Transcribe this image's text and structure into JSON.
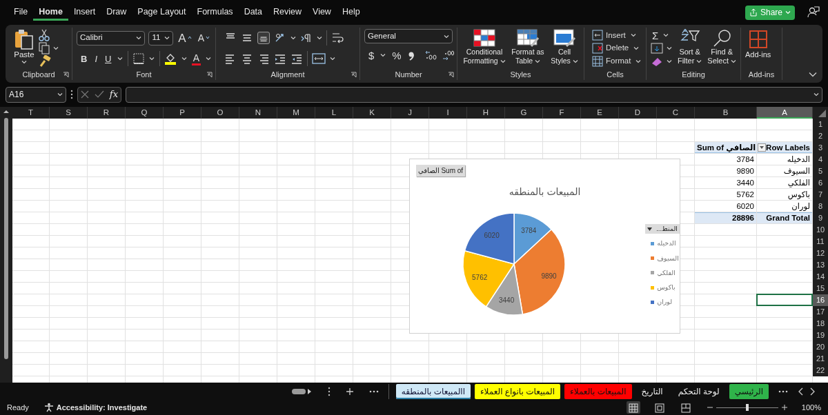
{
  "menu_tabs": [
    {
      "label": "File",
      "selected": false
    },
    {
      "label": "Home",
      "selected": true
    },
    {
      "label": "Insert",
      "selected": false
    },
    {
      "label": "Draw",
      "selected": false
    },
    {
      "label": "Page Layout",
      "selected": false
    },
    {
      "label": "Formulas",
      "selected": false
    },
    {
      "label": "Data",
      "selected": false
    },
    {
      "label": "Review",
      "selected": false
    },
    {
      "label": "View",
      "selected": false
    },
    {
      "label": "Help",
      "selected": false
    }
  ],
  "share_button": {
    "label": "Share"
  },
  "ribbon": {
    "clipboard": {
      "paste": "Paste",
      "label": "Clipboard"
    },
    "font": {
      "name": "Calibri",
      "size": "11",
      "increase_size": "A",
      "decrease_size": "A",
      "bold": "B",
      "italic": "I",
      "underline": "U",
      "font_color": "A",
      "label": "Font"
    },
    "alignment": {
      "bottom_align_selected": true,
      "label": "Alignment"
    },
    "number": {
      "format": "General",
      "currency": "$",
      "percent": "%",
      "label": "Number"
    },
    "styles": {
      "buttons": [
        "Conditional Formatting",
        "Format as Table",
        "Cell Styles"
      ],
      "label": "Styles"
    },
    "cells": {
      "buttons": [
        "Insert",
        "Delete",
        "Format"
      ],
      "label": "Cells"
    },
    "editing": {
      "autosum": "Σ",
      "buttons": [
        "Sort & Filter",
        "Find & Select"
      ],
      "label": "Editing"
    },
    "addins": {
      "button": "Add-ins",
      "label": "Add-ins"
    }
  },
  "formula_bar": {
    "name_box": "A16",
    "function_button": "fx"
  },
  "sheet": {
    "columns": [
      "T",
      "S",
      "R",
      "Q",
      "P",
      "O",
      "N",
      "M",
      "L",
      "K",
      "J",
      "I",
      "H",
      "G",
      "F",
      "E",
      "D",
      "C",
      "B",
      "A"
    ],
    "rows": [
      "1",
      "2",
      "3",
      "4",
      "5",
      "6",
      "7",
      "8",
      "9",
      "10",
      "11",
      "12",
      "13",
      "14",
      "15",
      "16",
      "17",
      "18",
      "19",
      "20",
      "21",
      "22"
    ],
    "pivot_table": {
      "row_labels_header": "Row Labels",
      "values_header": "Sum of الصافي",
      "rows": [
        {
          "label": "الدخيله",
          "value": "3784"
        },
        {
          "label": "السيوف",
          "value": "9890"
        },
        {
          "label": "الفلكي",
          "value": "3440"
        },
        {
          "label": "باكوس",
          "value": "5762"
        },
        {
          "label": "لوران",
          "value": "6020"
        }
      ],
      "total": {
        "label": "Grand Total",
        "value": "28896"
      }
    }
  },
  "chart": {
    "field_button": "Sum of الصافي",
    "chart_data": {
      "type": "pie",
      "title": "المبيعات بالمنطقه",
      "categories": [
        "الدخيله",
        "السيوف",
        "الفلكي",
        "باكوس",
        "لوران"
      ],
      "values": [
        3784,
        9890,
        3440,
        5762,
        6020
      ],
      "data_labels": true,
      "legend": "right"
    },
    "legend": {
      "field_button": "المنط...",
      "items": [
        {
          "color": "#5b9bd5"
        },
        {
          "color": "#ed7d31"
        },
        {
          "color": "#a5a5a5"
        },
        {
          "color": "#ffc000"
        },
        {
          "color": "#4472c4"
        }
      ]
    }
  },
  "sheet_tabs": [
    {
      "label": "الرئيسي",
      "selected": false,
      "color": "#2fb34a"
    },
    {
      "label": "لوحة التحكم",
      "selected": false
    },
    {
      "label": "التاريخ",
      "selected": false
    },
    {
      "label": "المبيعات بالعملاء",
      "selected": false,
      "color": "#ff0000"
    },
    {
      "label": "المبيعات بانواع العملاء",
      "selected": false,
      "color": "#ffff00"
    },
    {
      "label": "االمبيعات بالمنطقه",
      "selected": true
    }
  ],
  "status_bar": {
    "mode": "Ready",
    "accessibility": "Accessibility: Investigate",
    "views": [
      {
        "kind": "normal",
        "selected": true
      },
      {
        "kind": "page_layout",
        "selected": false
      },
      {
        "kind": "page_break",
        "selected": false
      }
    ],
    "zoom_slider": {
      "level": 0.5
    },
    "zoom_label": "100%"
  }
}
